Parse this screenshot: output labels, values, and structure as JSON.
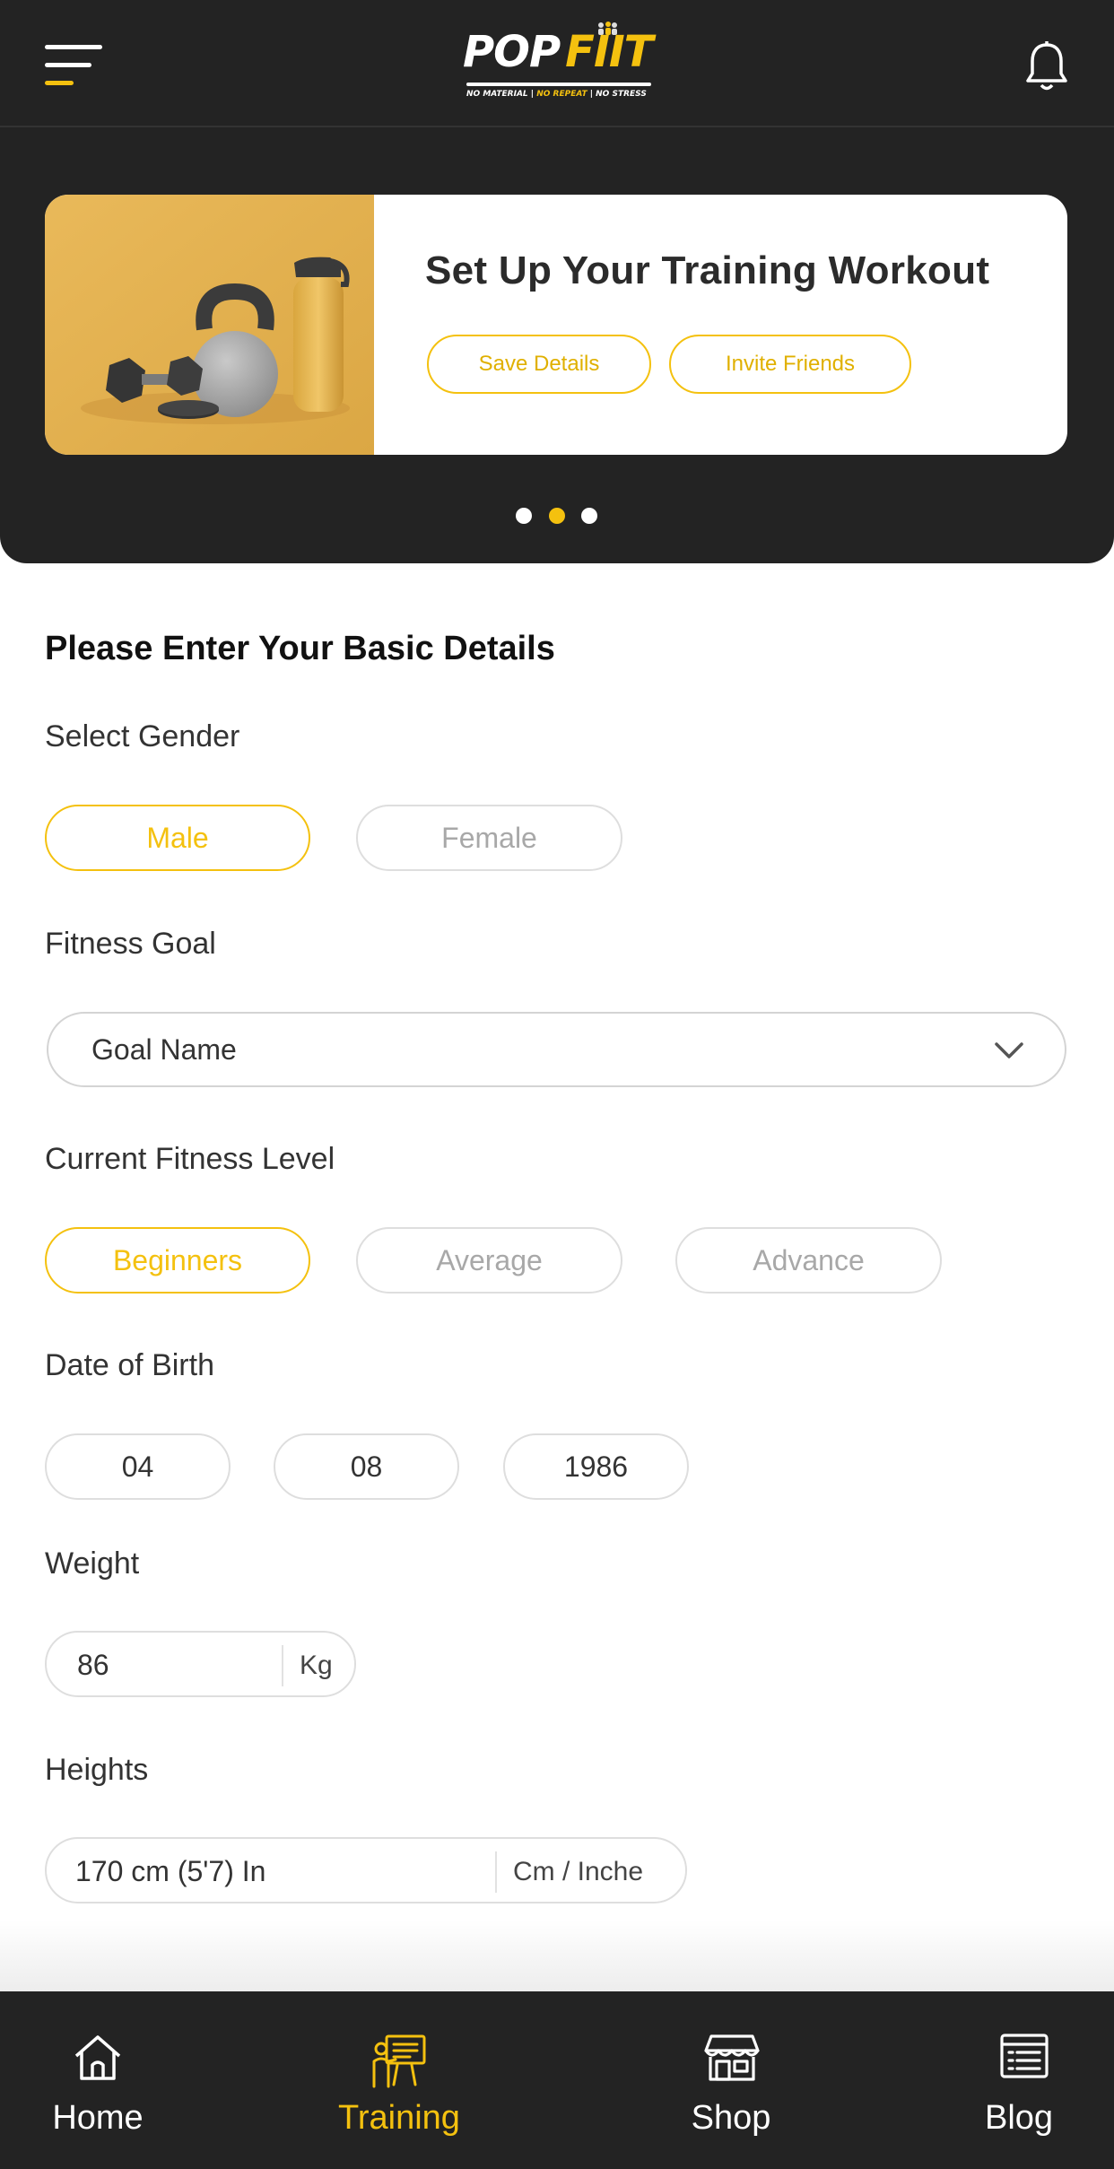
{
  "header": {
    "logo": {
      "word1": "POP",
      "word2": "FIIT",
      "tag_left": "NO MATERIAL | ",
      "tag_mid": "NO REPEAT",
      "tag_right": " | NO STRESS"
    },
    "menu_icon": "hamburger-menu-icon",
    "notification_icon": "bell-icon"
  },
  "banner": {
    "title": "Set Up Your Training Workout",
    "save_label": "Save Details",
    "invite_label": "Invite Friends",
    "image": "fitness-equipment-image",
    "slide_count": 3,
    "active_slide": 2
  },
  "form": {
    "title": "Please Enter Your Basic Details",
    "gender": {
      "label": "Select Gender",
      "options": [
        "Male",
        "Female"
      ],
      "selected": "Male"
    },
    "goal": {
      "label": "Fitness Goal",
      "value": "Goal Name"
    },
    "level": {
      "label": "Current Fitness Level",
      "options": [
        "Beginners",
        "Average",
        "Advance"
      ],
      "selected": "Beginners"
    },
    "dob": {
      "label": "Date of Birth",
      "day": "04",
      "month": "08",
      "year": "1986"
    },
    "weight": {
      "label": "Weight",
      "value": "86",
      "unit": "Kg"
    },
    "height": {
      "label": "Heights",
      "value": "170 cm (5'7) In",
      "unit": "Cm / Inche"
    }
  },
  "nav": {
    "items": [
      {
        "label": "Home",
        "icon": "home-icon"
      },
      {
        "label": "Training",
        "icon": "training-icon"
      },
      {
        "label": "Shop",
        "icon": "shop-icon"
      },
      {
        "label": "Blog",
        "icon": "blog-icon"
      }
    ],
    "active": "Training"
  },
  "colors": {
    "accent": "#f4c10f",
    "dark": "#232323",
    "border": "#dedede"
  }
}
